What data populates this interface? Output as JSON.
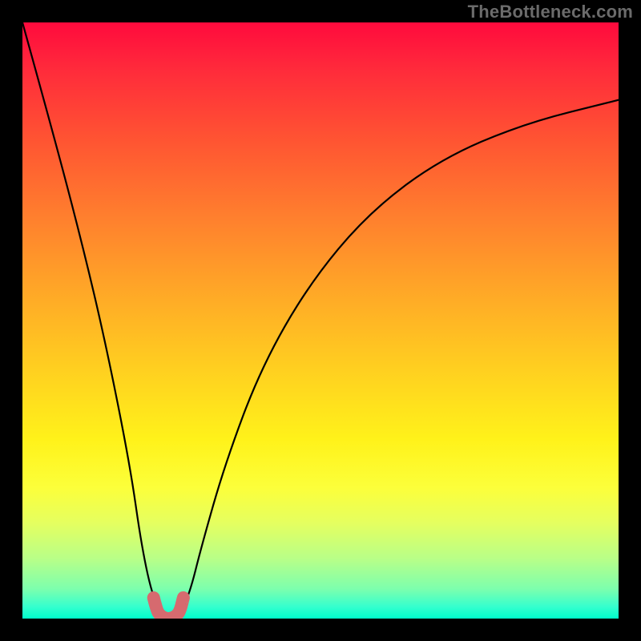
{
  "watermark": "TheBottleneck.com",
  "chart_data": {
    "type": "line",
    "title": "",
    "xlabel": "",
    "ylabel": "",
    "xlim": [
      0,
      100
    ],
    "ylim": [
      0,
      100
    ],
    "grid": false,
    "legend": false,
    "series": [
      {
        "name": "bottleneck-curve",
        "color": "#000000",
        "x": [
          0,
          5,
          10,
          14,
          18,
          20,
          22,
          24,
          25,
          26,
          28,
          30,
          34,
          40,
          48,
          58,
          70,
          84,
          100
        ],
        "y": [
          100,
          82,
          63,
          46,
          26,
          12,
          3,
          0,
          0,
          0,
          4,
          12,
          26,
          42,
          56,
          68,
          77,
          83,
          87
        ]
      },
      {
        "name": "minimum-highlight",
        "color": "#d66a6f",
        "x": [
          22.0,
          22.5,
          23.0,
          24.0,
          25.0,
          26.0,
          26.5,
          27.0
        ],
        "y": [
          3.5,
          1.5,
          0.6,
          0.0,
          0.0,
          0.6,
          1.5,
          3.5
        ]
      }
    ],
    "notes": "Values estimated from pixel positions; y is plotted increasing downward (bottleneck %)."
  },
  "colors": {
    "curve": "#000000",
    "highlight": "#d66a6f",
    "frame": "#000000"
  }
}
